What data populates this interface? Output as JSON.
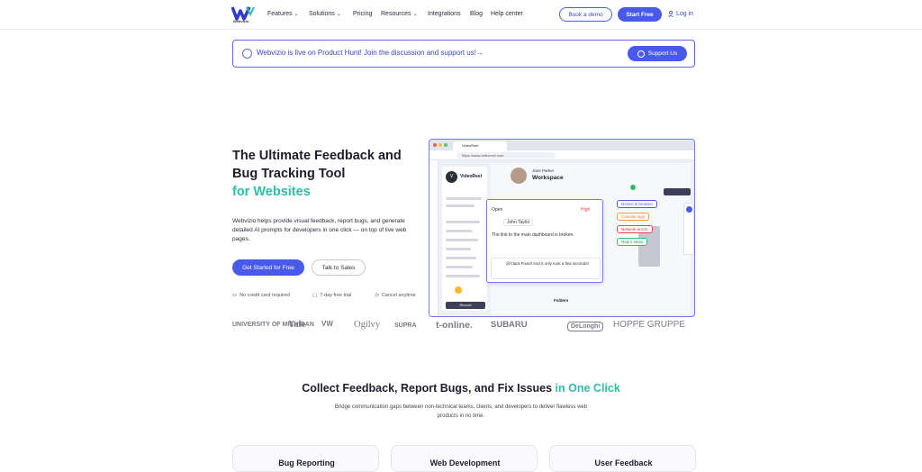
{
  "header": {
    "brand": "Webvizio",
    "nav": [
      {
        "label": "Features",
        "dropdown": true
      },
      {
        "label": "Solutions",
        "dropdown": true
      },
      {
        "label": "Pricing",
        "dropdown": false
      },
      {
        "label": "Resources",
        "dropdown": true
      },
      {
        "label": "Integrations",
        "dropdown": false
      },
      {
        "label": "Blog",
        "dropdown": false
      },
      {
        "label": "Help center",
        "dropdown": false
      }
    ],
    "book_demo": "Book a demo",
    "start_free": "Start Free",
    "login": "Log in"
  },
  "banner": {
    "text": "Webvizio is live on Product Hunt! Join the discussion and support us!→",
    "button": "Support Us"
  },
  "hero": {
    "title": "The Ultimate Feedback and Bug Tracking Tool",
    "title_accent": "for Websites",
    "description": "Webvizio helps provide visual feedback, report bugs, and generate detailed AI prompts for developers in one click — on top of live web pages.",
    "cta_primary": "Get Started for Free",
    "cta_secondary": "Talk to Sales",
    "features": [
      "No credit card required",
      "7-day free trial",
      "Cancel anytime"
    ]
  },
  "mockup": {
    "browser_url": "https://www.videoreel.com",
    "project": "VideoReel",
    "user_name": "Jane Parker",
    "workspace": "Workspace",
    "status": "Open",
    "priority": "High",
    "assignee": "John Taylor",
    "issue_text": "The link to the main dashboard is broken.",
    "comment": "@Clara Fixed! And it only took a few seconds!",
    "tags": [
      "Device & browser",
      "Console logs",
      "Network errors",
      "Repro steps"
    ],
    "folders_label": "Folders",
    "panel_button": "Record"
  },
  "logos": [
    "UNIVERSITY OF MICHIGAN",
    "Yale",
    "VW",
    "Ogilvy",
    "SUPRA",
    "t-online.",
    "SUBARU",
    "DeLonghi",
    "HOPPE GRUPPE"
  ],
  "section2": {
    "title": "Collect Feedback, Report Bugs, and Fix Issues",
    "title_accent": "in One Click",
    "description": "Bridge communication gaps between non-technical teams, clients, and developers to deliver flawless web products in no time."
  },
  "cards": [
    "Bug Reporting",
    "Web Development",
    "User Feedback"
  ],
  "colors": {
    "accent": "#4a5ae8",
    "teal": "#2bbfa5"
  }
}
